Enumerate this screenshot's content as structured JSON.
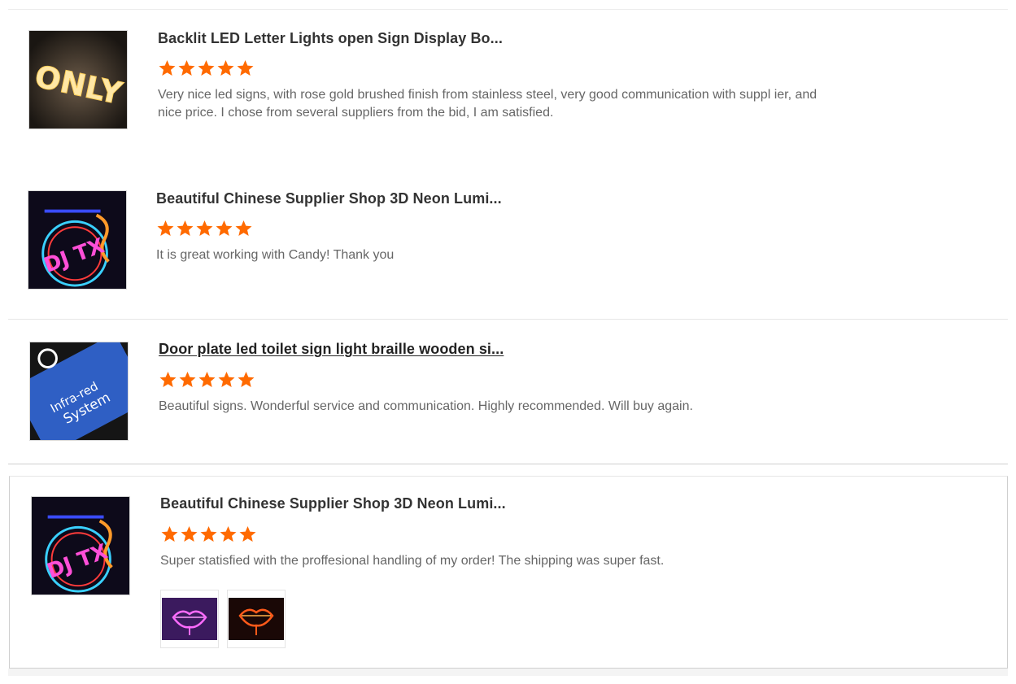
{
  "reviews": [
    {
      "title": "Backlit LED Letter Lights open Sign Display Bo...",
      "rating": 5,
      "text": "Very nice led signs, with rose gold brushed finish from stainless steel, very good communication with suppl ier, and nice price. I chose from several suppliers from the bid, I am satisfied.",
      "thumb_text": "ONLY"
    },
    {
      "title": "Beautiful Chinese Supplier Shop 3D Neon Lumi...",
      "rating": 5,
      "text": "It is great working with Candy! Thank you",
      "thumb_text": "DJ TX"
    },
    {
      "title": "Door plate led toilet sign light braille wooden si...",
      "rating": 5,
      "text": "Beautiful signs. Wonderful service and communication. Highly recommended. Will buy again.",
      "thumb_text_1": "Infra-red",
      "thumb_text_2": "System"
    },
    {
      "title": "Beautiful Chinese Supplier Shop 3D Neon Lumi...",
      "rating": 5,
      "text": "Super statisfied with the proffesional handling of my order! The shipping was super fast.",
      "thumb_text": "DJ TX",
      "photos": [
        "pink-neon-lips",
        "orange-neon-lips"
      ]
    }
  ],
  "colors": {
    "star": "#ff6a00",
    "title": "#333333",
    "text": "#666666",
    "divider": "#e6e6e6"
  }
}
